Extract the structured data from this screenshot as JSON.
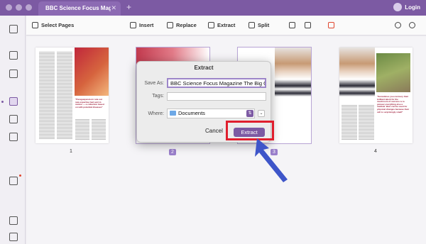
{
  "titlebar": {
    "tab_title": "BBC Science Focus Magazine The Big Questions",
    "close_tab": "✕",
    "new_tab": "+",
    "login_label": "Login"
  },
  "toolbar": {
    "select_pages": "Select Pages",
    "insert": "Insert",
    "replace": "Replace",
    "extract": "Extract",
    "split": "Split"
  },
  "pages": [
    {
      "number": "1",
      "quote": "\"Paraguayan-born rule out new expertise had sent in motion — a collection based on with potential diseases\""
    },
    {
      "number": "2"
    },
    {
      "number": "3"
    },
    {
      "number": "4",
      "quote": "\"Sometimes you can bury their brilliant talent for the mushroom of success is to pioneer everything else a medical 'idea' can be used for physical changes because their cell is surprisingly small\""
    }
  ],
  "dialog": {
    "title": "Extract",
    "save_as_label": "Save As:",
    "save_as_value": "BBC Science Focus Magazine The Big Questions",
    "tags_label": "Tags:",
    "tags_value": "",
    "where_label": "Where:",
    "where_value": "Documents",
    "cancel_label": "Cancel",
    "extract_label": "Extract"
  },
  "colors": {
    "accent": "#7c5aa3",
    "highlight": "#e01f2e",
    "arrow": "#3e55c9"
  }
}
